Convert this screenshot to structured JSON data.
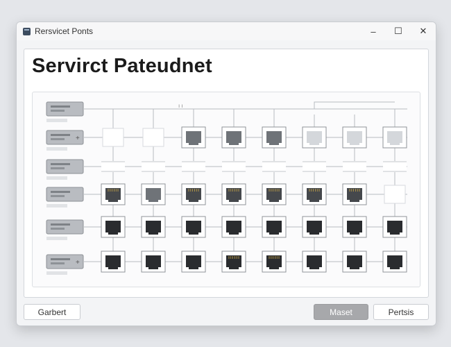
{
  "window": {
    "title": "Rersvicet Ponts",
    "controls": {
      "minimize": "–",
      "maximize": "☐",
      "close": "✕"
    }
  },
  "header": {
    "title": "Servirct Pateudnet"
  },
  "panel": {
    "top_mark": "ı ı",
    "row_devices": [
      {
        "row": 1,
        "with_plus": false
      },
      {
        "row": 2,
        "with_plus": true
      },
      {
        "row": 3,
        "with_plus": false
      },
      {
        "row": 4,
        "with_plus": false
      },
      {
        "row": 5,
        "with_plus": false
      },
      {
        "row": 6,
        "with_plus": true
      }
    ],
    "port_grid": [
      [
        "none",
        "none",
        "none",
        "none",
        "none",
        "none",
        "none",
        "none"
      ],
      [
        "blank",
        "blank",
        "gray",
        "gray",
        "gray",
        "light",
        "light",
        "light"
      ],
      [
        "strip",
        "strip",
        "strip",
        "strip",
        "strip",
        "strip",
        "strip",
        "strip"
      ],
      [
        "dark",
        "gray",
        "dark",
        "dark",
        "dark",
        "dark",
        "dark",
        "blank"
      ],
      [
        "black",
        "black",
        "black",
        "black",
        "black",
        "black",
        "black",
        "black"
      ],
      [
        "black",
        "black",
        "black",
        "gold",
        "gold",
        "black",
        "black",
        "black"
      ]
    ],
    "port_colors": {
      "light": "#d4d7db",
      "gray": "#6f7378",
      "dark": "#45484c",
      "black": "#2a2c2f",
      "gold": "#2a2c2f"
    }
  },
  "footer": {
    "left_label": "Garbert",
    "primary_label": "Maset",
    "secondary_label": "Pertsis"
  }
}
